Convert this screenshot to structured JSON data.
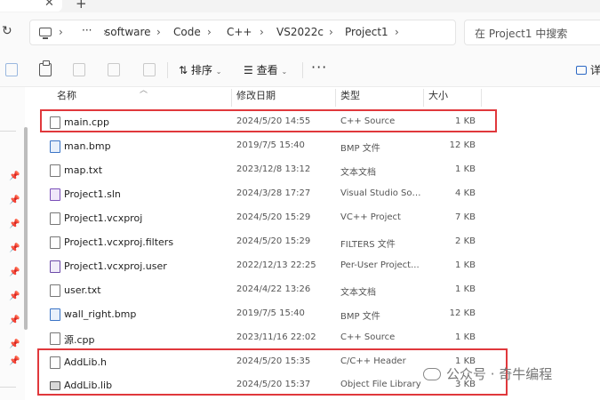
{
  "breadcrumb": {
    "more": "···",
    "items": [
      "software",
      "Code",
      "C++",
      "VS2022c",
      "Project1"
    ]
  },
  "search": {
    "placeholder": "在 Project1 中搜索"
  },
  "toolbar": {
    "sort_label": "排序",
    "view_label": "查看",
    "more_label": "···",
    "details_label": "详"
  },
  "columns": {
    "name": "名称",
    "modified": "修改日期",
    "type": "类型",
    "size": "大小"
  },
  "files": [
    {
      "name": "main.cpp",
      "modified": "2024/5/20 14:55",
      "type": "C++ Source",
      "size": "1 KB",
      "icon": "cpp-file-icon"
    },
    {
      "name": "man.bmp",
      "modified": "2019/7/5 15:40",
      "type": "BMP 文件",
      "size": "12 KB",
      "icon": "bmp-file-icon"
    },
    {
      "name": "map.txt",
      "modified": "2023/12/8 13:12",
      "type": "文本文档",
      "size": "1 KB",
      "icon": "txt-file-icon"
    },
    {
      "name": "Project1.sln",
      "modified": "2024/3/28 17:27",
      "type": "Visual Studio Sol...",
      "size": "4 KB",
      "icon": "sln-file-icon"
    },
    {
      "name": "Project1.vcxproj",
      "modified": "2024/5/20 15:29",
      "type": "VC++ Project",
      "size": "7 KB",
      "icon": "vcxproj-file-icon"
    },
    {
      "name": "Project1.vcxproj.filters",
      "modified": "2024/5/20 15:29",
      "type": "FILTERS 文件",
      "size": "2 KB",
      "icon": "filters-file-icon"
    },
    {
      "name": "Project1.vcxproj.user",
      "modified": "2022/12/13 22:25",
      "type": "Per-User Project...",
      "size": "1 KB",
      "icon": "user-file-icon"
    },
    {
      "name": "user.txt",
      "modified": "2024/4/22 13:26",
      "type": "文本文档",
      "size": "1 KB",
      "icon": "txt-file-icon"
    },
    {
      "name": "wall_right.bmp",
      "modified": "2019/7/5 15:40",
      "type": "BMP 文件",
      "size": "12 KB",
      "icon": "bmp-file-icon"
    },
    {
      "name": "源.cpp",
      "modified": "2023/11/16 22:02",
      "type": "C++ Source",
      "size": "1 KB",
      "icon": "cpp-file-icon"
    },
    {
      "name": "AddLib.h",
      "modified": "2024/5/20 15:35",
      "type": "C/C++ Header",
      "size": "1 KB",
      "icon": "header-file-icon"
    },
    {
      "name": "AddLib.lib",
      "modified": "2024/5/20 15:37",
      "type": "Object File Library",
      "size": "3 KB",
      "icon": "lib-file-icon"
    }
  ],
  "watermark": {
    "text": "公众号 · 奇牛编程"
  },
  "colors": {
    "highlight": "#e0383c",
    "accent": "#2b67c4"
  }
}
